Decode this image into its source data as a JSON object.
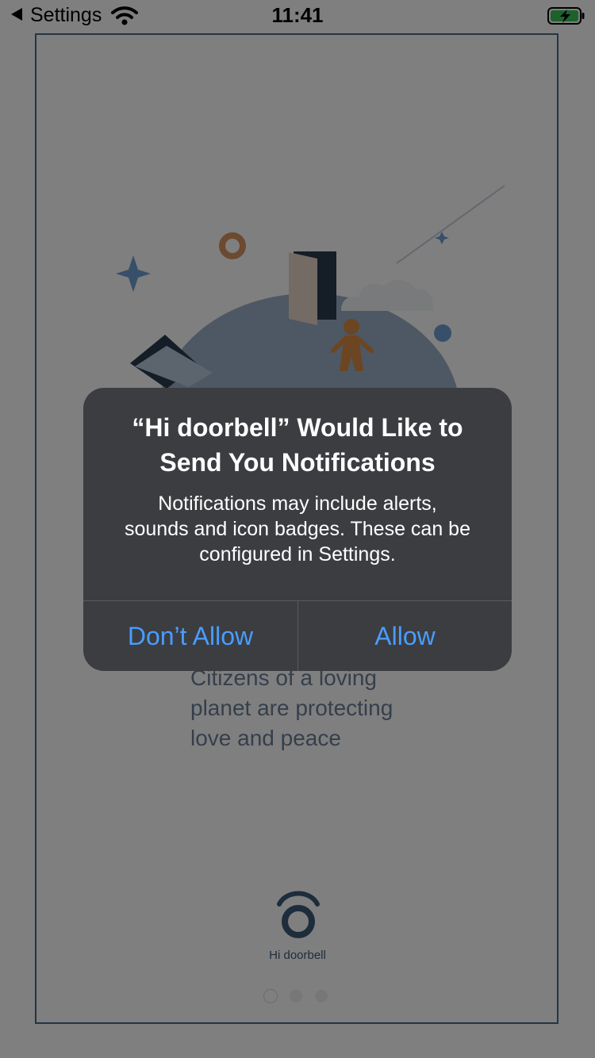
{
  "status_bar": {
    "back_label": "Settings",
    "time": "11:41",
    "wifi_icon": "wifi-icon",
    "battery_icon": "battery-charging-icon"
  },
  "splash": {
    "tagline_lines": [
      "Citizens of a loving",
      "planet are protecting",
      "love and peace"
    ],
    "brand_name": "Hi doorbell",
    "page_count": 3,
    "active_page": 1
  },
  "alert": {
    "title_lines": [
      "“Hi doorbell” Would Like to",
      "Send You Notifications"
    ],
    "message_lines": [
      "Notifications may include alerts,",
      "sounds and icon badges. These can be",
      "configured in Settings."
    ],
    "deny_label": "Don’t Allow",
    "allow_label": "Allow"
  },
  "colors": {
    "alert_button": "#4a9cff",
    "alert_background": "#3b3d40",
    "brand": "#3d5a78"
  }
}
